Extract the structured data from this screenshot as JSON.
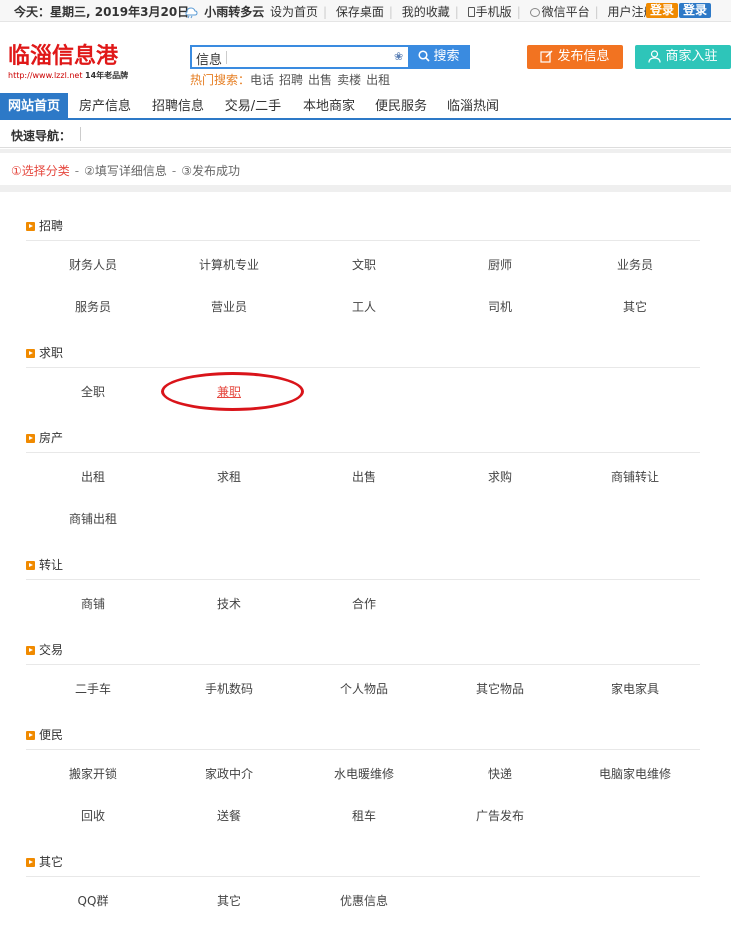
{
  "topbar": {
    "date": "今天：星期三, 2019年3月20日",
    "weather": "小雨转多云",
    "links": [
      "设为首页",
      "保存桌面",
      "我的收藏",
      "手机版",
      "微信平台",
      "用户注册"
    ],
    "login1": "登录",
    "login2": "登录"
  },
  "header": {
    "logo_main": "临淄信息港",
    "logo_url": "http://www.lzzl.net",
    "logo_tag": "14年老品牌",
    "search_category": "信息",
    "search_button": "搜索",
    "hot_label": "热门搜索：",
    "hot_keywords": [
      "电话",
      "招聘",
      "出售",
      "卖楼",
      "出租"
    ],
    "publish_button": "发布信息",
    "merchant_button": "商家入驻"
  },
  "nav": {
    "items": [
      "网站首页",
      "房产信息",
      "招聘信息",
      "交易/二手",
      "本地商家",
      "便民服务",
      "临淄热闻"
    ]
  },
  "quick": {
    "label": "快速导航："
  },
  "steps": {
    "step1": "①选择分类",
    "step2": "②填写详细信息",
    "step3": "③发布成功",
    "sep": "-"
  },
  "sections": [
    {
      "title": "招聘",
      "items": [
        "财务人员",
        "计算机专业",
        "文职",
        "厨师",
        "业务员",
        "服务员",
        "营业员",
        "工人",
        "司机",
        "其它"
      ]
    },
    {
      "title": "求职",
      "items": [
        "全职",
        "兼职"
      ]
    },
    {
      "title": "房产",
      "items": [
        "出租",
        "求租",
        "出售",
        "求购",
        "商铺转让",
        "商铺出租"
      ]
    },
    {
      "title": "转让",
      "items": [
        "商铺",
        "技术",
        "合作"
      ]
    },
    {
      "title": "交易",
      "items": [
        "二手车",
        "手机数码",
        "个人物品",
        "其它物品",
        "家电家具"
      ]
    },
    {
      "title": "便民",
      "items": [
        "搬家开锁",
        "家政中介",
        "水电暖维修",
        "快递",
        "电脑家电维修",
        "回收",
        "送餐",
        "租车",
        "广告发布"
      ]
    },
    {
      "title": "其它",
      "items": [
        "QQ群",
        "其它",
        "优惠信息"
      ]
    }
  ],
  "colors": {
    "accent_blue": "#2d79c7",
    "orange": "#f27321",
    "teal": "#2ec5b9",
    "red": "#e01818",
    "highlight_oval": "#d9141a"
  }
}
